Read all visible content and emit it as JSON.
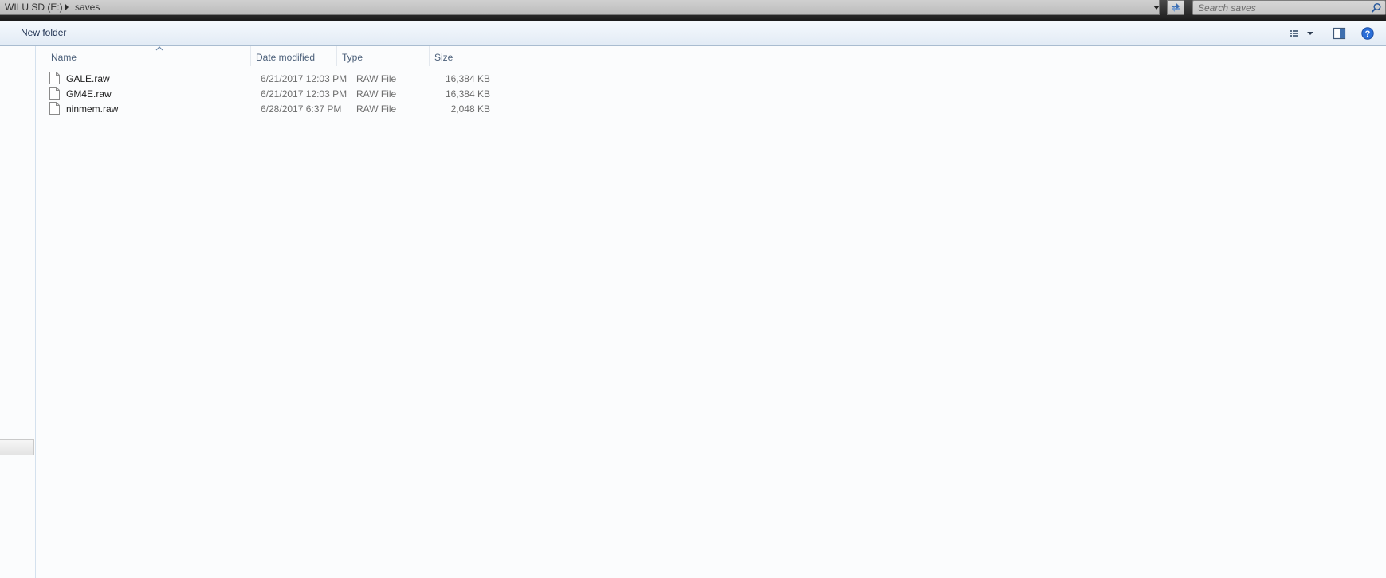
{
  "address_bar": {
    "drive": "WII U SD (E:)",
    "folder": "saves"
  },
  "search": {
    "placeholder": "Search saves"
  },
  "command_bar": {
    "new_folder_label": "New folder"
  },
  "columns": {
    "name": "Name",
    "date_modified": "Date modified",
    "type": "Type",
    "size": "Size"
  },
  "files": [
    {
      "name": "GALE.raw",
      "date_modified": "6/21/2017 12:03 PM",
      "type": "RAW File",
      "size": "16,384 KB"
    },
    {
      "name": "GM4E.raw",
      "date_modified": "6/21/2017 12:03 PM",
      "type": "RAW File",
      "size": "16,384 KB"
    },
    {
      "name": "ninmem.raw",
      "date_modified": "6/28/2017 6:37 PM",
      "type": "RAW File",
      "size": "2,048 KB"
    }
  ],
  "colors": {
    "help_blue": "#2a6ed8",
    "header_text": "#4c607a",
    "meta_text": "#6d6d6d"
  }
}
